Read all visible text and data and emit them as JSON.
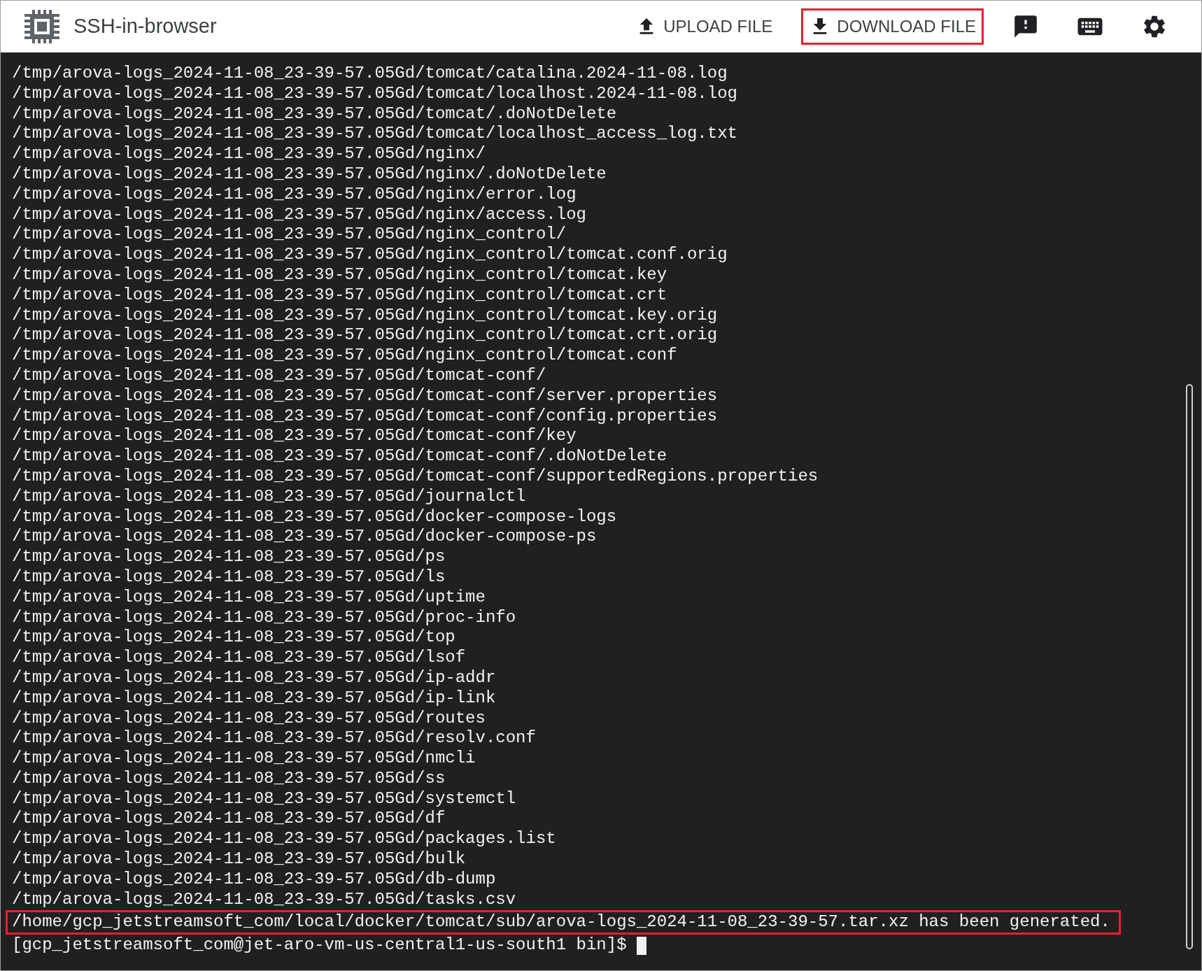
{
  "app": {
    "title": "SSH-in-browser"
  },
  "toolbar": [
    {
      "kind": "upload",
      "label": "UPLOAD FILE",
      "highlighted": false
    },
    {
      "kind": "download",
      "label": "DOWNLOAD FILE",
      "highlighted": true
    },
    {
      "kind": "feedback"
    },
    {
      "kind": "keyboard"
    },
    {
      "kind": "settings"
    }
  ],
  "terminal": {
    "lines": [
      {
        "text": "/tmp/arova-logs_2024-11-08_23-39-57.05Gd/tomcat/catalina.2024-11-08.log",
        "highlighted": false
      },
      {
        "text": "/tmp/arova-logs_2024-11-08_23-39-57.05Gd/tomcat/localhost.2024-11-08.log",
        "highlighted": false
      },
      {
        "text": "/tmp/arova-logs_2024-11-08_23-39-57.05Gd/tomcat/.doNotDelete",
        "highlighted": false
      },
      {
        "text": "/tmp/arova-logs_2024-11-08_23-39-57.05Gd/tomcat/localhost_access_log.txt",
        "highlighted": false
      },
      {
        "text": "/tmp/arova-logs_2024-11-08_23-39-57.05Gd/nginx/",
        "highlighted": false
      },
      {
        "text": "/tmp/arova-logs_2024-11-08_23-39-57.05Gd/nginx/.doNotDelete",
        "highlighted": false
      },
      {
        "text": "/tmp/arova-logs_2024-11-08_23-39-57.05Gd/nginx/error.log",
        "highlighted": false
      },
      {
        "text": "/tmp/arova-logs_2024-11-08_23-39-57.05Gd/nginx/access.log",
        "highlighted": false
      },
      {
        "text": "/tmp/arova-logs_2024-11-08_23-39-57.05Gd/nginx_control/",
        "highlighted": false
      },
      {
        "text": "/tmp/arova-logs_2024-11-08_23-39-57.05Gd/nginx_control/tomcat.conf.orig",
        "highlighted": false
      },
      {
        "text": "/tmp/arova-logs_2024-11-08_23-39-57.05Gd/nginx_control/tomcat.key",
        "highlighted": false
      },
      {
        "text": "/tmp/arova-logs_2024-11-08_23-39-57.05Gd/nginx_control/tomcat.crt",
        "highlighted": false
      },
      {
        "text": "/tmp/arova-logs_2024-11-08_23-39-57.05Gd/nginx_control/tomcat.key.orig",
        "highlighted": false
      },
      {
        "text": "/tmp/arova-logs_2024-11-08_23-39-57.05Gd/nginx_control/tomcat.crt.orig",
        "highlighted": false
      },
      {
        "text": "/tmp/arova-logs_2024-11-08_23-39-57.05Gd/nginx_control/tomcat.conf",
        "highlighted": false
      },
      {
        "text": "/tmp/arova-logs_2024-11-08_23-39-57.05Gd/tomcat-conf/",
        "highlighted": false
      },
      {
        "text": "/tmp/arova-logs_2024-11-08_23-39-57.05Gd/tomcat-conf/server.properties",
        "highlighted": false
      },
      {
        "text": "/tmp/arova-logs_2024-11-08_23-39-57.05Gd/tomcat-conf/config.properties",
        "highlighted": false
      },
      {
        "text": "/tmp/arova-logs_2024-11-08_23-39-57.05Gd/tomcat-conf/key",
        "highlighted": false
      },
      {
        "text": "/tmp/arova-logs_2024-11-08_23-39-57.05Gd/tomcat-conf/.doNotDelete",
        "highlighted": false
      },
      {
        "text": "/tmp/arova-logs_2024-11-08_23-39-57.05Gd/tomcat-conf/supportedRegions.properties",
        "highlighted": false
      },
      {
        "text": "/tmp/arova-logs_2024-11-08_23-39-57.05Gd/journalctl",
        "highlighted": false
      },
      {
        "text": "/tmp/arova-logs_2024-11-08_23-39-57.05Gd/docker-compose-logs",
        "highlighted": false
      },
      {
        "text": "/tmp/arova-logs_2024-11-08_23-39-57.05Gd/docker-compose-ps",
        "highlighted": false
      },
      {
        "text": "/tmp/arova-logs_2024-11-08_23-39-57.05Gd/ps",
        "highlighted": false
      },
      {
        "text": "/tmp/arova-logs_2024-11-08_23-39-57.05Gd/ls",
        "highlighted": false
      },
      {
        "text": "/tmp/arova-logs_2024-11-08_23-39-57.05Gd/uptime",
        "highlighted": false
      },
      {
        "text": "/tmp/arova-logs_2024-11-08_23-39-57.05Gd/proc-info",
        "highlighted": false
      },
      {
        "text": "/tmp/arova-logs_2024-11-08_23-39-57.05Gd/top",
        "highlighted": false
      },
      {
        "text": "/tmp/arova-logs_2024-11-08_23-39-57.05Gd/lsof",
        "highlighted": false
      },
      {
        "text": "/tmp/arova-logs_2024-11-08_23-39-57.05Gd/ip-addr",
        "highlighted": false
      },
      {
        "text": "/tmp/arova-logs_2024-11-08_23-39-57.05Gd/ip-link",
        "highlighted": false
      },
      {
        "text": "/tmp/arova-logs_2024-11-08_23-39-57.05Gd/routes",
        "highlighted": false
      },
      {
        "text": "/tmp/arova-logs_2024-11-08_23-39-57.05Gd/resolv.conf",
        "highlighted": false
      },
      {
        "text": "/tmp/arova-logs_2024-11-08_23-39-57.05Gd/nmcli",
        "highlighted": false
      },
      {
        "text": "/tmp/arova-logs_2024-11-08_23-39-57.05Gd/ss",
        "highlighted": false
      },
      {
        "text": "/tmp/arova-logs_2024-11-08_23-39-57.05Gd/systemctl",
        "highlighted": false
      },
      {
        "text": "/tmp/arova-logs_2024-11-08_23-39-57.05Gd/df",
        "highlighted": false
      },
      {
        "text": "/tmp/arova-logs_2024-11-08_23-39-57.05Gd/packages.list",
        "highlighted": false
      },
      {
        "text": "/tmp/arova-logs_2024-11-08_23-39-57.05Gd/bulk",
        "highlighted": false
      },
      {
        "text": "/tmp/arova-logs_2024-11-08_23-39-57.05Gd/db-dump",
        "highlighted": false
      },
      {
        "text": "/tmp/arova-logs_2024-11-08_23-39-57.05Gd/tasks.csv",
        "highlighted": false
      },
      {
        "text": "/home/gcp_jetstreamsoft_com/local/docker/tomcat/sub/arova-logs_2024-11-08_23-39-57.tar.xz has been generated.",
        "highlighted": true
      }
    ],
    "prompt": "[gcp_jetstreamsoft_com@jet-aro-vm-us-central1-us-south1 bin]$"
  }
}
